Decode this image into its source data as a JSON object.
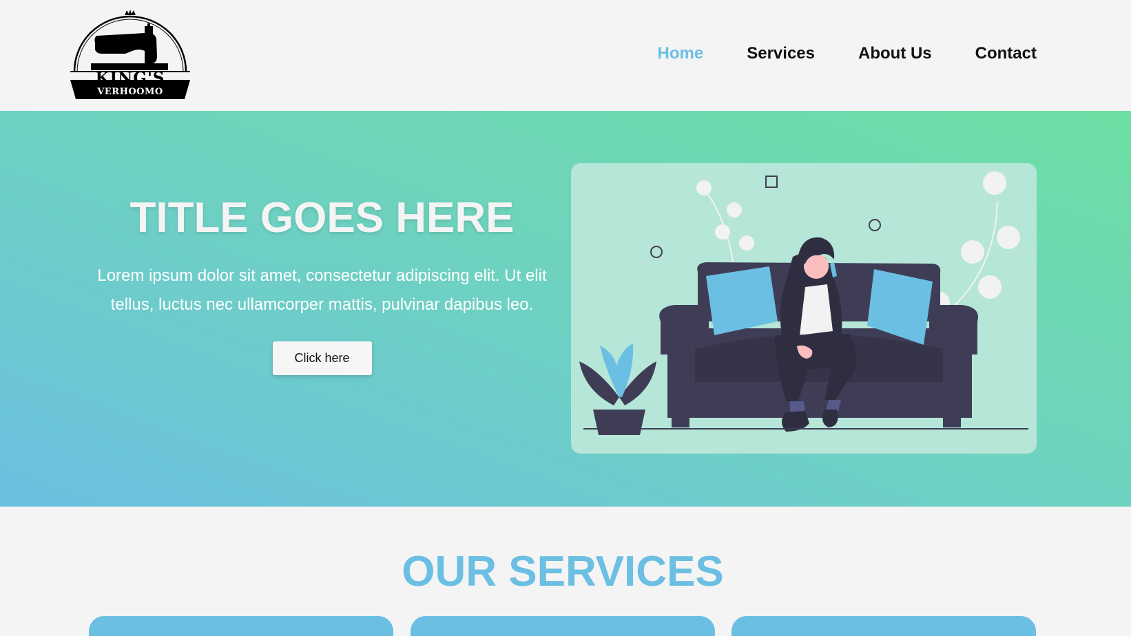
{
  "logo": {
    "name": "KING'S",
    "subtitle": "VERHOOMO"
  },
  "nav": {
    "items": [
      {
        "label": "Home",
        "active": true
      },
      {
        "label": "Services",
        "active": false
      },
      {
        "label": "About Us",
        "active": false
      },
      {
        "label": "Contact",
        "active": false
      }
    ]
  },
  "hero": {
    "title": "TITLE GOES HERE",
    "text": "Lorem ipsum dolor sit amet, consectetur adipiscing elit. Ut elit tellus, luctus nec ullamcorper mattis, pulvinar dapibus leo.",
    "button_label": "Click here",
    "illustration": "person-on-sofa-phone-illustration"
  },
  "services": {
    "title": "OUR SERVICES",
    "card_count_visible": 3
  },
  "colors": {
    "accent": "#6bbfe3",
    "gradient_start": "#6cbfe0",
    "gradient_end": "#6ddfa3",
    "sofa": "#3f3d56",
    "cushion": "#6bbfe3",
    "background": "#f4f4f4"
  }
}
